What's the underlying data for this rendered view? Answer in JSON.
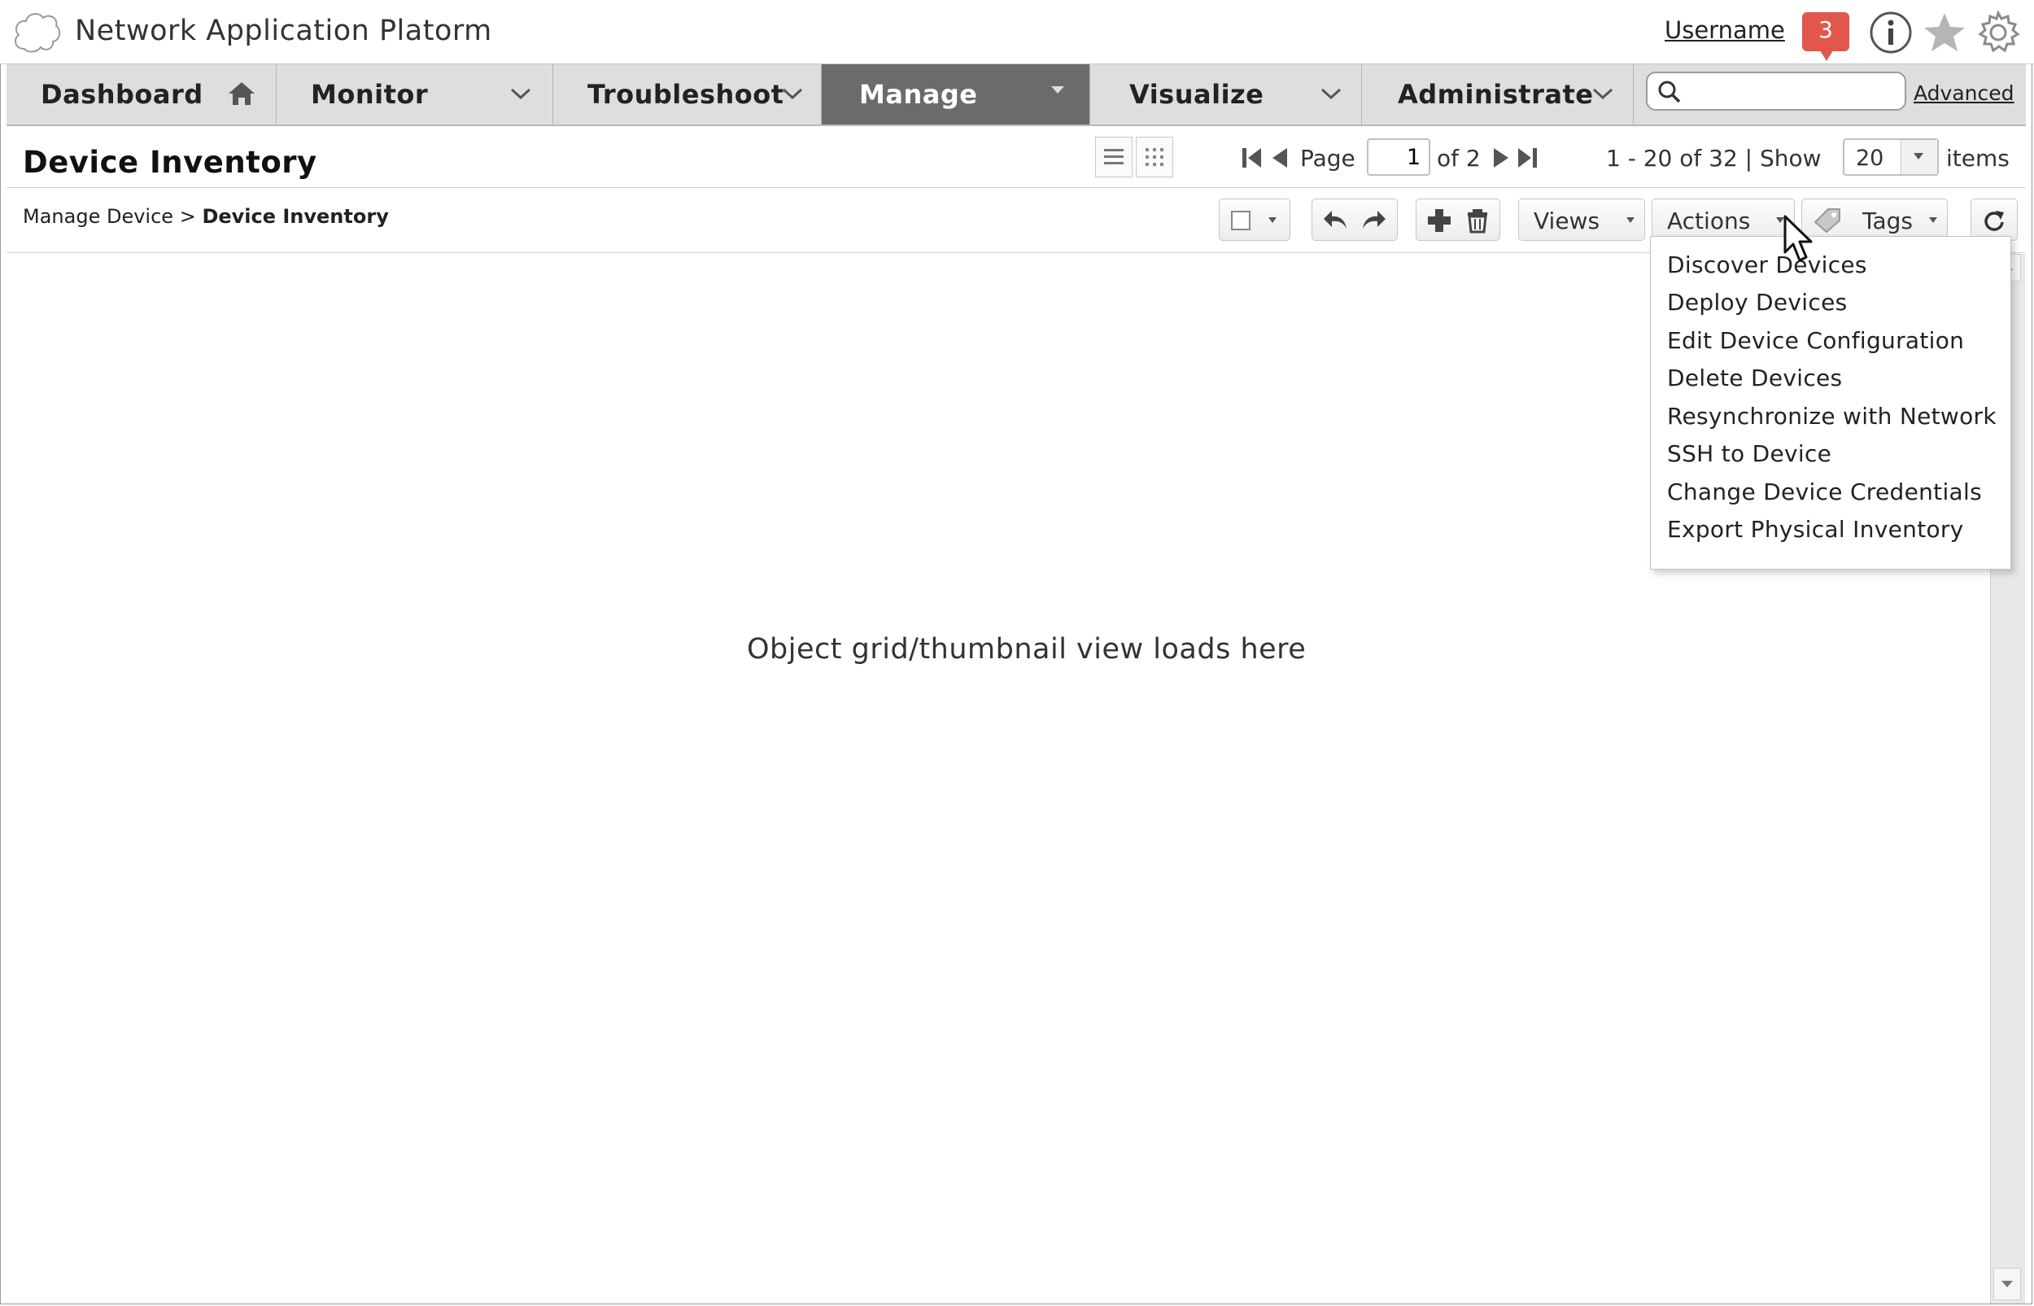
{
  "app": {
    "title": "Network Application Platorm",
    "username": "Username",
    "notification_count": "3",
    "icons": [
      "cloud-logo-icon",
      "info-icon",
      "star-icon",
      "gear-icon"
    ]
  },
  "nav": {
    "items": [
      {
        "label": "Dashboard",
        "icon": "home-icon"
      },
      {
        "label": "Monitor",
        "icon": "chevron-down-icon"
      },
      {
        "label": "Troubleshoot",
        "icon": "chevron-down-icon"
      },
      {
        "label": "Manage",
        "icon": "caret-down-icon",
        "active": true
      },
      {
        "label": "Visualize",
        "icon": "chevron-down-icon"
      },
      {
        "label": "Administrate",
        "icon": "chevron-down-icon"
      }
    ],
    "search": {
      "value": "",
      "placeholder": ""
    },
    "advanced_label": "Advanced"
  },
  "page": {
    "title": "Device Inventory",
    "pager": {
      "page_label": "Page",
      "current_page": "1",
      "of_label": "of 2",
      "range_label": "1 - 20 of 32 | Show",
      "show_value": "20",
      "items_label": "items"
    },
    "breadcrumb": {
      "parent": "Manage Device",
      "separator": ">",
      "current": "Device Inventory"
    },
    "toolbar": {
      "views_label": "Views",
      "actions_label": "Actions",
      "tags_label": "Tags"
    },
    "content_message": "Object grid/thumbnail view loads here"
  },
  "actions_menu": {
    "items": [
      "Discover Devices",
      "Deploy Devices",
      "Edit Device Configuration",
      "Delete Devices",
      "Resynchronize with Network",
      "SSH to Device",
      "Change Device Credentials",
      "Export Physical Inventory"
    ]
  },
  "colors": {
    "nav_background": "#dedede",
    "nav_active": "#6b6b6b",
    "notification_badge": "#e2574c"
  }
}
